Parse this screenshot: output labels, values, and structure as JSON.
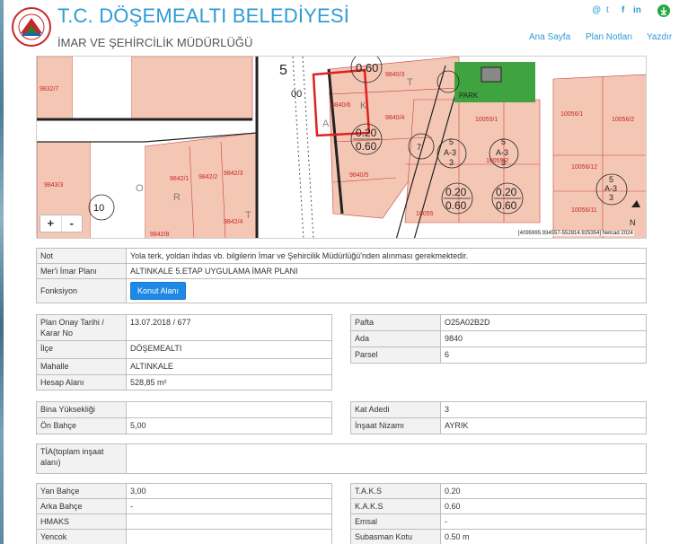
{
  "header": {
    "title": "T.C. DÖŞEMEALTI BELEDİYESİ",
    "subtitle": "İMAR VE ŞEHİRCİLİK MÜDÜRLÜĞÜ",
    "logo_text": "DÖŞEMEALTI BELEDİYESİ",
    "social": [
      "@",
      "t",
      "f",
      "in"
    ],
    "download_icon": "download-icon",
    "nav": [
      "Ana Sayfa",
      "Plan Notları",
      "Yazdır"
    ]
  },
  "map": {
    "zoom_in": "+",
    "zoom_out": "-",
    "attribution": "[4095995.934557-552814.925354] Netcad 2024",
    "road_label": "ORTAK",
    "park_label": "PARK",
    "parcels": [
      "9832/7",
      "9840/3",
      "9840/6",
      "9840/4",
      "9840/5",
      "9843/3",
      "9842/1",
      "9842/2",
      "9842/3",
      "9842/4",
      "9842/8",
      "10055/1",
      "10055/2",
      "10055",
      "10056/1",
      "10056/2",
      "10056/12",
      "10056/11"
    ],
    "circle_labels": [
      "0.20",
      "0.60",
      "5",
      "A-3",
      "3",
      "7.00",
      "10.00",
      "5.00"
    ],
    "north": "N"
  },
  "fields": {
    "note_label": "Not",
    "note_value": "Yola terk, yoldan ihdas vb. bilgilerin İmar ve Şehircilik Müdürlüğü'nden alınması gerekmektedir.",
    "plan_label": "Mer'i İmar Planı",
    "plan_value": "ALTINKALE 5.ETAP UYGULAMA İMAR PLANI",
    "function_label": "Fonksiyon",
    "function_button": "Konut Alanı",
    "approval_label": "Plan Onay Tarihi / Karar No",
    "approval_value": "13.07.2018 / 677",
    "district_label": "İlçe",
    "district_value": "DÖŞEMEALTI",
    "neighborhood_label": "Mahalle",
    "neighborhood_value": "ALTINKALE",
    "area_label": "Hesap Alanı",
    "area_value": "528,85 m²",
    "pafta_label": "Pafta",
    "pafta_value": "O25A02B2D",
    "ada_label": "Ada",
    "ada_value": "9840",
    "parsel_label": "Parsel",
    "parsel_value": "6",
    "height_label": "Bina Yüksekliği",
    "height_value": "",
    "front_label": "Ön Bahçe",
    "front_value": "5,00",
    "floors_label": "Kat Adedi",
    "floors_value": "3",
    "order_label": "İnşaat Nizamı",
    "order_value": "AYRIK",
    "tia_label": "TİA(toplam inşaat alanı)",
    "tia_value": "",
    "side_label": "Yan Bahçe",
    "side_value": "3,00",
    "rear_label": "Arka Bahçe",
    "rear_value": "-",
    "hmaks_label": "HMAKS",
    "hmaks_value": "",
    "yencok_label": "Yencok",
    "yencok_value": "",
    "taks_label": "T.A.K.S",
    "taks_value": "0.20",
    "kaks_label": "K.A.K.S",
    "kaks_value": "0.60",
    "emsal_label": "Emsal",
    "emsal_value": "-",
    "subasman_label": "Subasman Kotu",
    "subasman_value": "0.50 m"
  },
  "colors": {
    "brand_blue": "#2f9bd6",
    "button_blue": "#1e88e5",
    "parcel_fill": "#f4c7b5",
    "selection_red": "#e02020",
    "park_green": "#3fa33f"
  }
}
